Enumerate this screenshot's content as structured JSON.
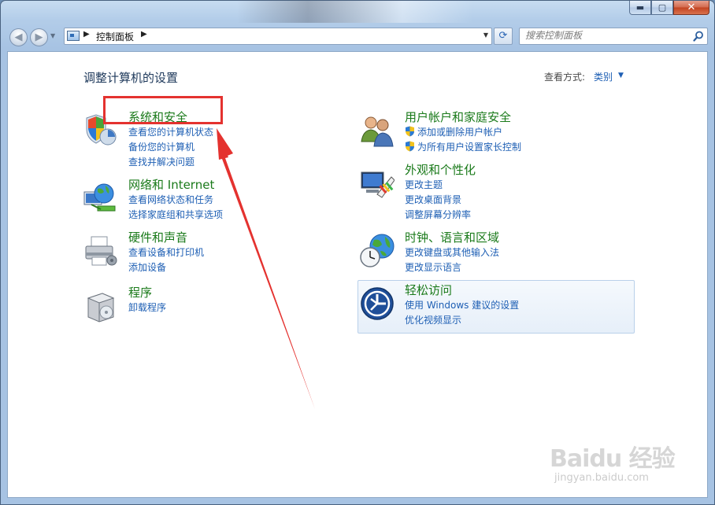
{
  "window": {
    "caption_minimize": "▬",
    "caption_maximize": "▢",
    "caption_close": "✕"
  },
  "toolbar": {
    "breadcrumb": "控制面板",
    "search_placeholder": "搜索控制面板"
  },
  "header": {
    "title": "调整计算机的设置",
    "view_by_label": "查看方式:",
    "view_by_value": "类别"
  },
  "categories": {
    "system": {
      "title": "系统和安全",
      "links": [
        "查看您的计算机状态",
        "备份您的计算机",
        "查找并解决问题"
      ]
    },
    "network": {
      "title": "网络和 Internet",
      "links": [
        "查看网络状态和任务",
        "选择家庭组和共享选项"
      ]
    },
    "hardware": {
      "title": "硬件和声音",
      "links": [
        "查看设备和打印机",
        "添加设备"
      ]
    },
    "programs": {
      "title": "程序",
      "links": [
        "卸载程序"
      ]
    },
    "users": {
      "title": "用户帐户和家庭安全",
      "links": [
        "添加或删除用户帐户",
        "为所有用户设置家长控制"
      ]
    },
    "appearance": {
      "title": "外观和个性化",
      "links": [
        "更改主题",
        "更改桌面背景",
        "调整屏幕分辨率"
      ]
    },
    "clock": {
      "title": "时钟、语言和区域",
      "links": [
        "更改键盘或其他输入法",
        "更改显示语言"
      ]
    },
    "access": {
      "title": "轻松访问",
      "links": [
        "使用 Windows 建议的设置",
        "优化视频显示"
      ]
    }
  },
  "annotation": {
    "color": "#e4322f"
  },
  "watermark": {
    "logo": "Baidu 经验",
    "url": "jingyan.baidu.com"
  }
}
